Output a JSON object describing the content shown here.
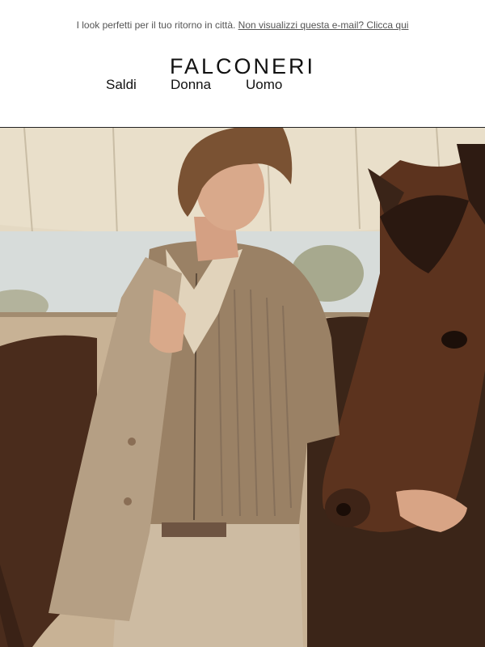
{
  "preheader": {
    "text": "I look perfetti per il tuo ritorno in città.",
    "link_label": "Non visualizzi questa e-mail? Clicca qui"
  },
  "brand": {
    "logo_text": "FALCONERI"
  },
  "nav": {
    "items": [
      {
        "label": "Saldi"
      },
      {
        "label": "Donna"
      },
      {
        "label": "Uomo"
      }
    ]
  },
  "hero": {
    "description": "",
    "colors": {
      "tent": "#e6dcc6",
      "sky": "#d9dedd",
      "sand": "#c9b193",
      "horse_dark": "#3a2418",
      "horse_light": "#6b3b22",
      "knit": "#9c8468",
      "jacket": "#b7a186",
      "shirt": "#e3d6bf"
    }
  }
}
